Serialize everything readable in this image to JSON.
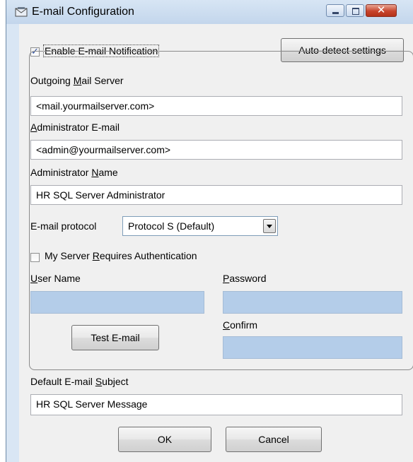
{
  "window": {
    "title": "E-mail Configuration",
    "icon": "mail-config-icon",
    "controls": [
      "minimize",
      "maximize",
      "close"
    ],
    "close_glyph": "✕"
  },
  "notification": {
    "enable_checkbox": {
      "label": "Enable E-mail Notification",
      "checked": true
    },
    "auto_detect_button": "Auto-detect settings"
  },
  "server": {
    "outgoing_label_pre": "Outgoing ",
    "outgoing_label_u": "M",
    "outgoing_label_post": "ail Server",
    "outgoing_value": "<mail.yourmailserver.com>",
    "admin_email_label_u": "A",
    "admin_email_label_post": "dministrator E-mail",
    "admin_email_value": "<admin@yourmailserver.com>",
    "admin_name_label_pre": "Administrator ",
    "admin_name_label_u": "N",
    "admin_name_label_post": "ame",
    "admin_name_value": "HR SQL Server Administrator",
    "protocol_label": "E-mail protocol",
    "protocol_value": "Protocol S (Default)"
  },
  "auth": {
    "requires_auth": {
      "label_pre": "My Server ",
      "label_u": "R",
      "label_post": "equires Authentication",
      "checked": false
    },
    "user_name_label_u": "U",
    "user_name_label_post": "ser Name",
    "user_name_value": "",
    "password_label_u": "P",
    "password_label_post": "assword",
    "password_value": "",
    "confirm_label_u": "C",
    "confirm_label_post": "onfirm",
    "confirm_value": "",
    "test_button": "Test E-mail"
  },
  "subject": {
    "label_pre": "Default E-mail ",
    "label_u": "S",
    "label_post": "ubject",
    "value": "HR SQL Server Message"
  },
  "footer": {
    "ok": "OK",
    "cancel": "Cancel"
  },
  "colors": {
    "title_bar": "#c3d6ec",
    "disabled_field": "#b4cde9",
    "close_button": "#c8442c"
  }
}
